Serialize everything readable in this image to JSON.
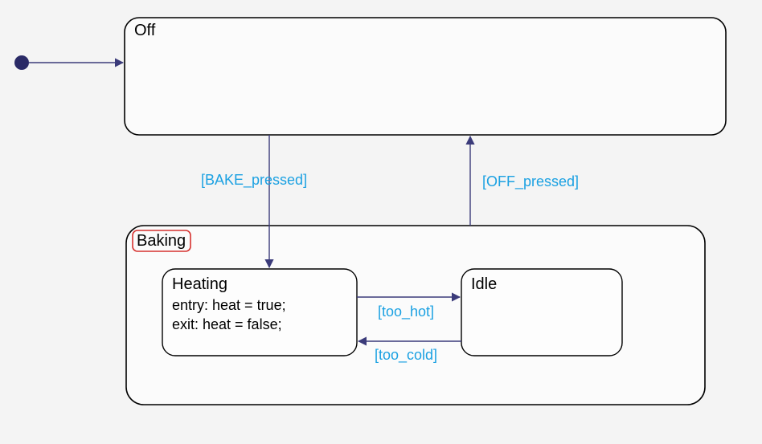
{
  "diagram": {
    "states": {
      "off": {
        "name": "Off"
      },
      "baking": {
        "name": "Baking",
        "substates": {
          "heating": {
            "name": "Heating",
            "entry": "entry: heat = true;",
            "exit": "exit: heat = false;"
          },
          "idle": {
            "name": "Idle"
          }
        }
      }
    },
    "transitions": {
      "initial_to_off": {
        "guard": ""
      },
      "off_to_baking": {
        "guard": "[BAKE_pressed]"
      },
      "baking_to_off": {
        "guard": "[OFF_pressed]"
      },
      "heating_to_idle": {
        "guard": "[too_hot]"
      },
      "idle_to_heating": {
        "guard": "[too_cold]"
      }
    }
  }
}
